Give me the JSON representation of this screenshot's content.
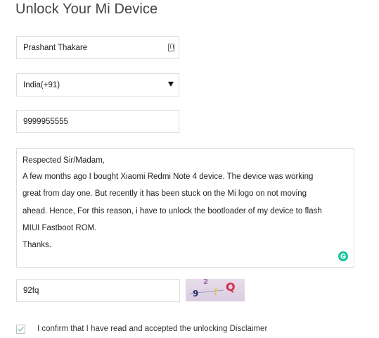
{
  "page": {
    "title": "Unlock Your Mi Device"
  },
  "form": {
    "name_value": "Prashant Thakare",
    "country_selected": "India(+91)",
    "phone_value": "9999955555",
    "message_lines": [
      "Respected Sir/Madam,",
      "A few months ago I bought Xiaomi Redmi Note 4 device. The device was working",
      "great from day one. But recently it has been stuck on the Mi logo on not moving",
      "ahead. Hence, For this reason, i have to unlock the bootloader of my device to flash",
      "MIUI Fastboot ROM.",
      "Thanks."
    ],
    "captcha_value": "92fq",
    "captcha_chars": [
      "9",
      "2",
      "f",
      "Q"
    ],
    "agree_label": "I confirm that I have read and accepted the unlocking Disclaimer",
    "agree_checked": true
  },
  "icons": {
    "name_field_icon": "autofill-key-icon",
    "country_dropdown": "chevron-down-icon",
    "message_extension": "grammarly-icon",
    "checkbox": "checkmark-icon"
  },
  "colors": {
    "border": "#dcdcdc",
    "grammarly": "#15c39a",
    "checkmark": "#7cc8a0"
  }
}
